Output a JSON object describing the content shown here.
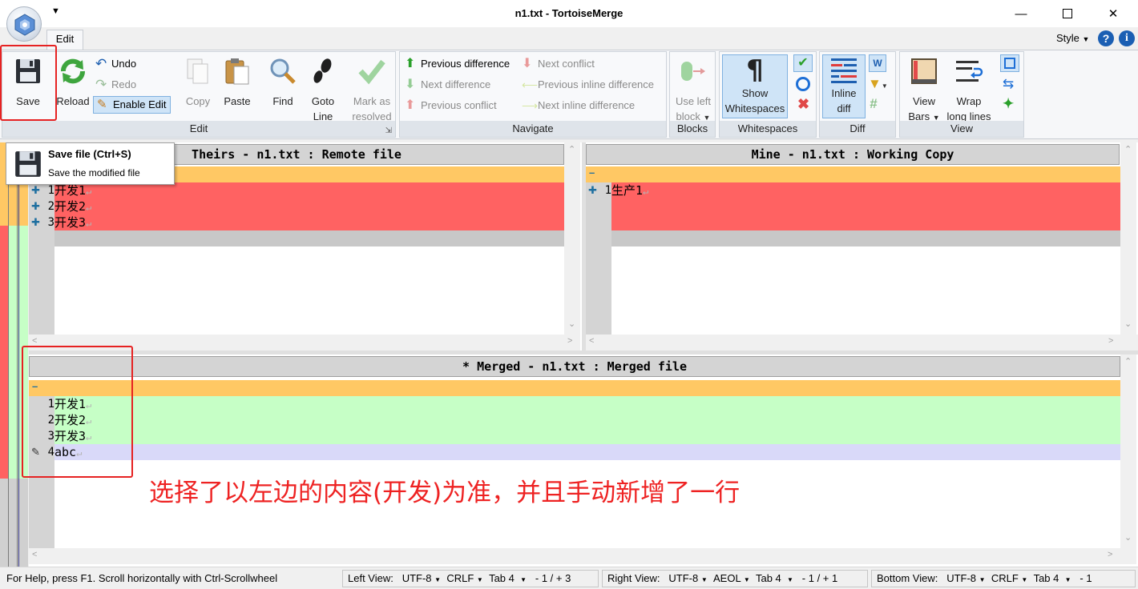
{
  "window": {
    "title": "n1.txt - TortoiseMerge",
    "minimize_icon": "minimize-icon",
    "maximize_icon": "maximize-icon",
    "close_icon": "close-icon"
  },
  "tabs": {
    "edit": "Edit",
    "style": "Style",
    "help_icon": "?",
    "info_icon": "i"
  },
  "ribbon": {
    "edit_group": {
      "label": "Edit",
      "save": "Save",
      "reload": "Reload",
      "undo": "Undo",
      "redo": "Redo",
      "enable_edit": "Enable Edit",
      "copy": "Copy",
      "paste": "Paste",
      "find": "Find",
      "goto_line_1": "Goto",
      "goto_line_2": "Line",
      "mark_resolved_1": "Mark as",
      "mark_resolved_2": "resolved"
    },
    "navigate_group": {
      "label": "Navigate",
      "previous_difference": "Previous difference",
      "next_difference": "Next difference",
      "previous_conflict": "Previous conflict",
      "next_conflict": "Next conflict",
      "previous_inline_difference": "Previous inline difference",
      "next_inline_difference": "Next inline difference"
    },
    "blocks_group": {
      "label": "Blocks",
      "use_left_block_1": "Use left",
      "use_left_block_2": "block"
    },
    "whitespaces_group": {
      "label": "Whitespaces",
      "show_1": "Show",
      "show_2": "Whitespaces"
    },
    "diff_group": {
      "label": "Diff",
      "inline_diff_1": "Inline",
      "inline_diff_2": "diff"
    },
    "view_group": {
      "label": "View",
      "view_bars_1": "View",
      "view_bars_2": "Bars",
      "wrap_1": "Wrap",
      "wrap_2": "long lines"
    }
  },
  "tooltip": {
    "title": "Save file (Ctrl+S)",
    "description": "Save the modified file"
  },
  "panes": {
    "theirs": {
      "header": "Theirs - n1.txt : Remote file",
      "lines": [
        {
          "no": "1",
          "text": "开发1"
        },
        {
          "no": "2",
          "text": "开发2"
        },
        {
          "no": "3",
          "text": "开发3"
        }
      ]
    },
    "mine": {
      "header": "Mine - n1.txt : Working Copy",
      "lines": [
        {
          "no": "1",
          "text": "生产1"
        }
      ]
    },
    "merged": {
      "header": "* Merged - n1.txt : Merged file",
      "lines": [
        {
          "no": "1",
          "text": "开发1"
        },
        {
          "no": "2",
          "text": "开发2"
        },
        {
          "no": "3",
          "text": "开发3"
        },
        {
          "no": "4",
          "text": "abc"
        }
      ]
    }
  },
  "annotation": "选择了以左边的内容(开发)为准，并且手动新增了一行",
  "statusbar": {
    "help": "For Help, press F1. Scroll horizontally with Ctrl-Scrollwheel",
    "left_view": "Left View:",
    "left_encoding": "UTF-8",
    "left_eol": "CRLF",
    "left_tab": "Tab 4",
    "left_changes": "- 1 / + 3",
    "right_view": "Right View:",
    "right_encoding": "UTF-8",
    "right_eol": "AEOL",
    "right_tab": "Tab 4",
    "right_changes": "- 1 / + 1",
    "bottom_view": "Bottom View:",
    "bottom_encoding": "UTF-8",
    "bottom_eol": "CRLF",
    "bottom_tab": "Tab 4",
    "bottom_changes": "- 1"
  },
  "colors": {
    "conflict_red": "#ff6262",
    "conflict_orange": "#ffc864",
    "resolved_green": "#c6ffc6",
    "edited_lavender": "#d9d9f9",
    "empty_gray": "#c8c8c8",
    "annotation_red": "#ee2222"
  }
}
